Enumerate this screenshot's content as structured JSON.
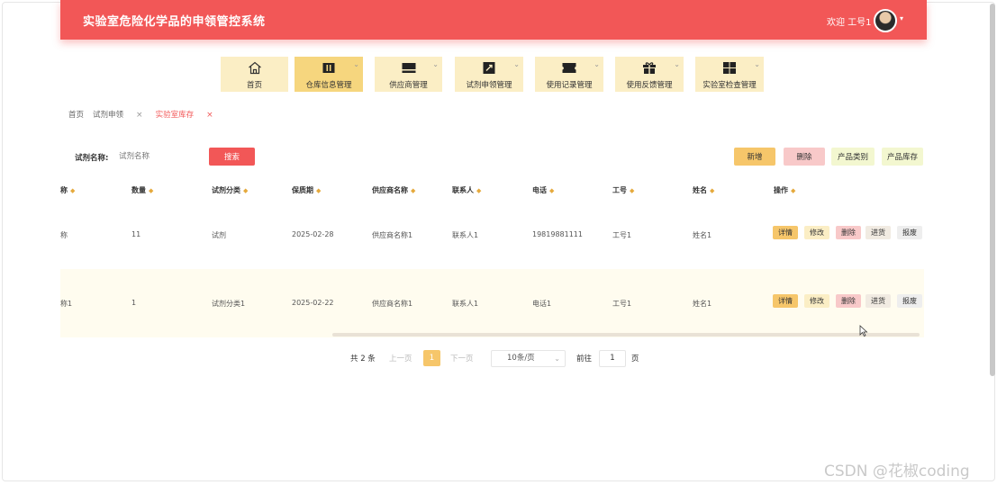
{
  "app": {
    "title": "实验室危险化学品的申领管控系统",
    "welcome": "欢迎 工号1",
    "accent": "#f25757"
  },
  "nav": [
    {
      "label": "首页",
      "icon": "home-icon",
      "active": false
    },
    {
      "label": "仓库信息管理",
      "icon": "warehouse-icon",
      "active": true
    },
    {
      "label": "供应商管理",
      "icon": "supplier-icon",
      "active": false
    },
    {
      "label": "试剂申领管理",
      "icon": "requisition-icon",
      "active": false
    },
    {
      "label": "使用记录管理",
      "icon": "ticket-icon",
      "active": false
    },
    {
      "label": "使用反馈管理",
      "icon": "gift-icon",
      "active": false
    },
    {
      "label": "实验室检查管理",
      "icon": "grid-icon",
      "active": false
    }
  ],
  "breadcrumb": {
    "home": "首页",
    "tab1": "试剂申领",
    "tab2": "实验室库存"
  },
  "search": {
    "label": "试剂名称:",
    "placeholder": "试剂名称",
    "button": "搜索"
  },
  "toolbar": {
    "add": "新增",
    "delete": "删除",
    "category": "产品类别",
    "stock": "产品库存"
  },
  "table": {
    "columns": [
      "称",
      "数量",
      "试剂分类",
      "保质期",
      "供应商名称",
      "联系人",
      "电话",
      "工号",
      "姓名",
      "操作"
    ],
    "rows": [
      {
        "name": "称",
        "qty": "11",
        "category": "试剂",
        "expiry": "2025-02-28",
        "supplier": "供应商名称1",
        "contact": "联系人1",
        "phone": "19819881111",
        "staff_no": "工号1",
        "person": "姓名1"
      },
      {
        "name": "称1",
        "qty": "1",
        "category": "试剂分类1",
        "expiry": "2025-02-22",
        "supplier": "供应商名称1",
        "contact": "联系人1",
        "phone": "电话1",
        "staff_no": "工号1",
        "person": "姓名1"
      }
    ],
    "actions": {
      "detail": "详情",
      "edit": "修改",
      "delete": "删除",
      "restock": "进货",
      "scrap": "报废"
    }
  },
  "pagination": {
    "total": "共 2 条",
    "prev": "上一页",
    "current": "1",
    "next": "下一页",
    "page_size": "10条/页",
    "goto_label": "前往",
    "goto_value": "1",
    "page_suffix": "页"
  },
  "watermark": "CSDN @花椒coding"
}
